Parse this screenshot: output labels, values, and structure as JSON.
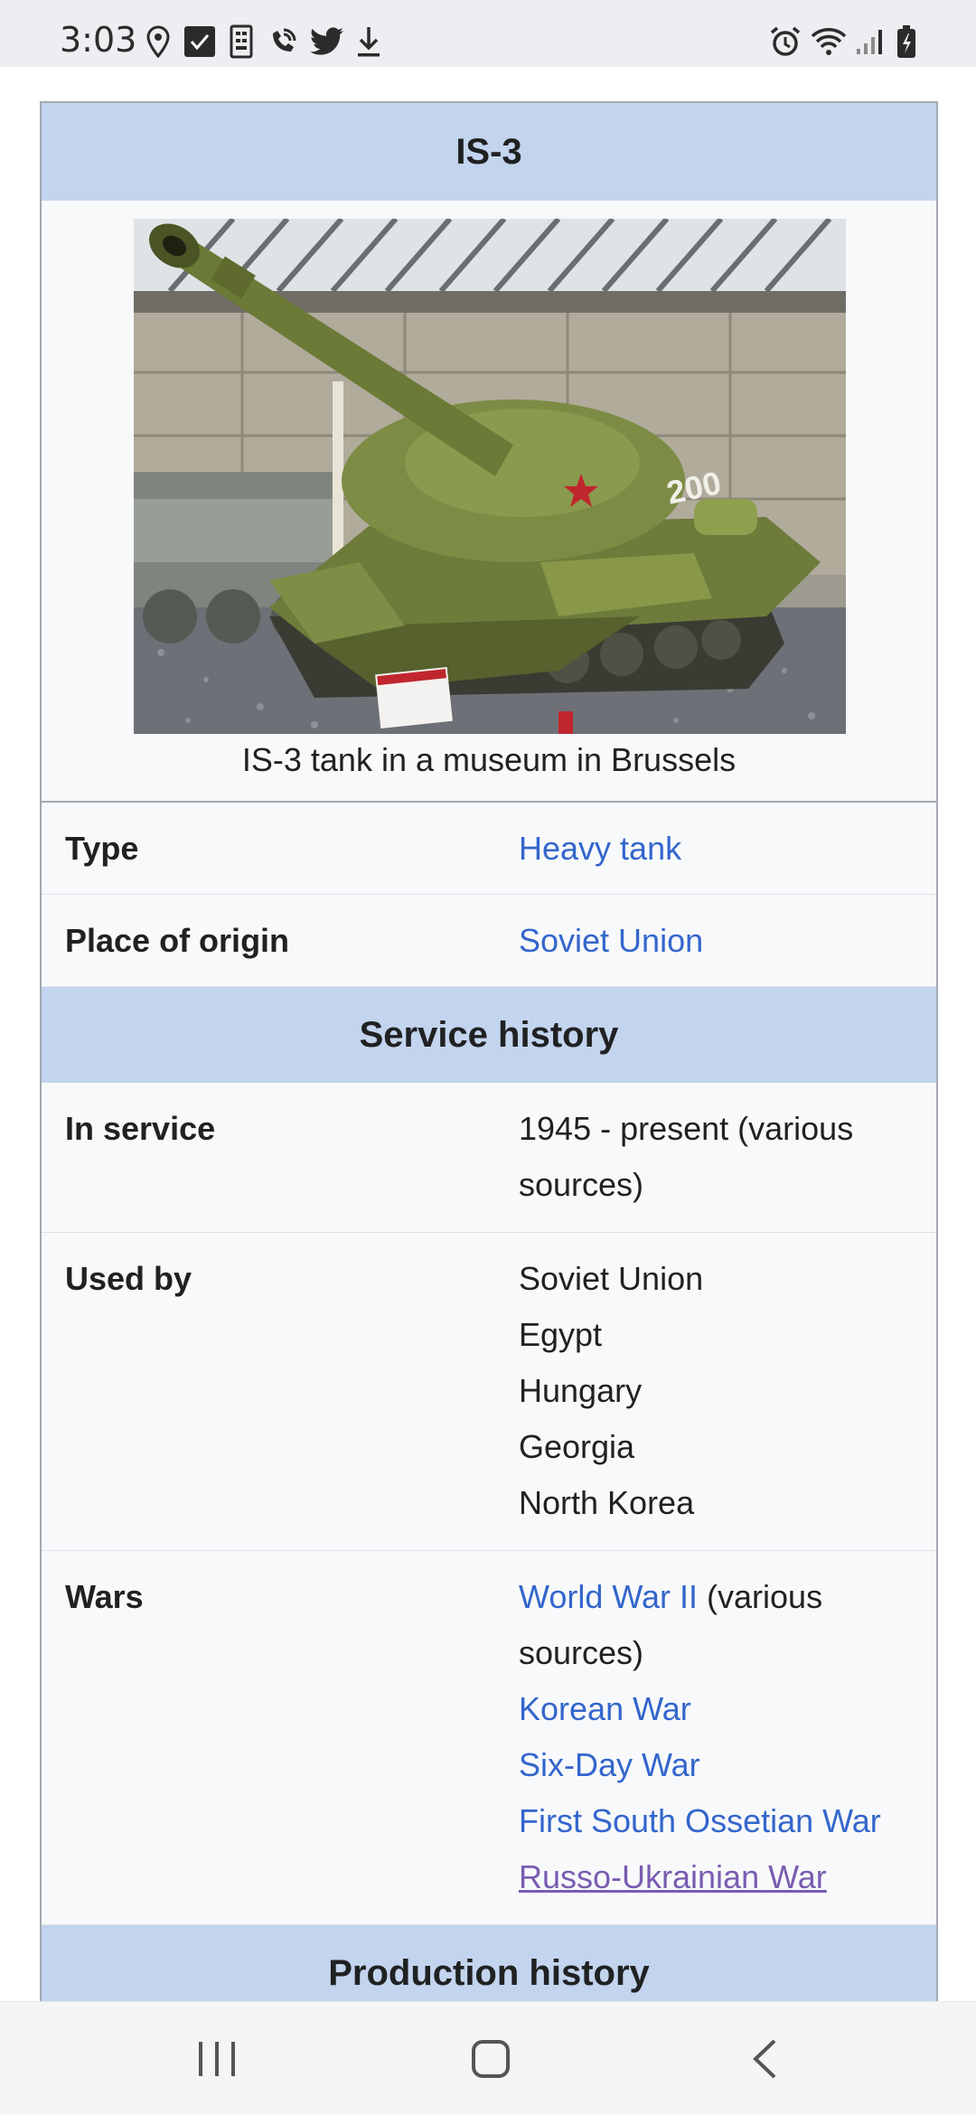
{
  "status_bar": {
    "time": "3:03",
    "left_icons": [
      "location-pin-icon",
      "call-filter-icon",
      "sim-icon",
      "wifi-calling-icon",
      "twitter-icon",
      "download-icon"
    ],
    "right_icons": [
      "alarm-icon",
      "wifi-icon",
      "signal-icon",
      "battery-icon"
    ]
  },
  "infobox": {
    "title": "IS-3",
    "image_caption": "IS-3 tank in a museum in Brussels",
    "type_label": "Type",
    "type_value": "Heavy tank",
    "origin_label": "Place of origin",
    "origin_value": "Soviet Union",
    "service_history_header": "Service history",
    "in_service_label": "In service",
    "in_service_line1": "1945 - present (various",
    "in_service_line2": "sources)",
    "used_by_label": "Used by",
    "used_by": [
      "Soviet Union",
      "Egypt",
      "Hungary",
      "Georgia",
      "North Korea"
    ],
    "wars_label": "Wars",
    "wars_first_link": "World War II",
    "wars_first_suffix": " (various",
    "wars_first_line2": "sources)",
    "wars_links": [
      "Korean War",
      "Six-Day War",
      "First South Ossetian War"
    ],
    "wars_visited_link": "Russo-Ukrainian War",
    "production_history_header": "Production history",
    "tank_marking": "200"
  },
  "colors": {
    "header_bg": "#c3d4ee",
    "link": "#3366cc",
    "visited_link": "#795cb2",
    "infobox_bg": "#f8f9fa"
  },
  "nav_bar": {
    "icons": [
      "recent-apps-icon",
      "home-icon",
      "back-icon"
    ]
  }
}
